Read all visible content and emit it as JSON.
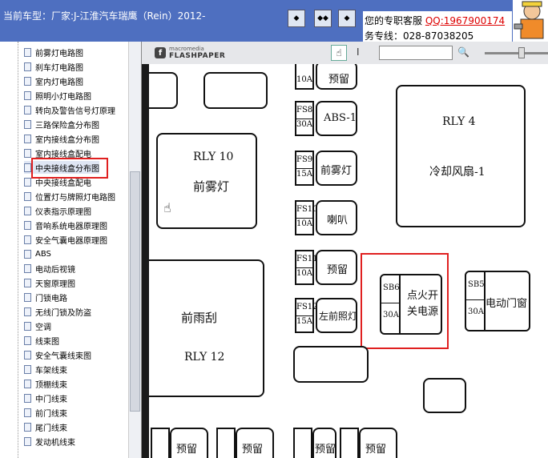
{
  "header": {
    "current_model": "当前车型：厂家:J-江淮汽车瑞鹰（Rein）2012-",
    "support_label": "您的专职客服",
    "qq": "QQ:1967900174",
    "hotline": "务专线：028-87038205",
    "nav_buttons": [
      "◆",
      "◆◆",
      "◆"
    ]
  },
  "sidebar": {
    "items": [
      "前雾灯电路图",
      "刹车灯电路图",
      "室内灯电路图",
      "照明小灯电路图",
      "转向及警告信号灯原理",
      "三路保险盒分布图",
      "室内接线盒分布图",
      "室内接线盒配电",
      "中央接线盒分布图",
      "中央接线盒配电",
      "位置灯与牌照灯电路图",
      "仪表指示原理图",
      "音响系统电器原理图",
      "安全气囊电器原理图",
      "ABS",
      "电动后视镜",
      "天窗原理图",
      "门锁电路",
      "无线门锁及防盗",
      "空调",
      "线束图",
      "安全气囊线束图",
      "车架线束",
      "顶棚线束",
      "中门线束",
      "前门线束",
      "尾门线束",
      "发动机线束"
    ],
    "selected_index": 8
  },
  "viewer": {
    "logo_top": "macromedia",
    "logo_bottom": "FLASHPAPER",
    "logo_f": "f",
    "hand_icon": "☝",
    "ibeam_icon": "I",
    "magnify_icon": "🔍",
    "diagram": {
      "rly10": "RLY 10",
      "fog_front": "前雾灯",
      "rly4": "RLY 4",
      "fan_low": "冷却风扇-1",
      "front_wiper": "前雨刮",
      "rly12": "RLY 12",
      "fs8": "FS8",
      "fs8_amp": "30A",
      "abs1": "ABS-1",
      "fs9": "FS9",
      "fs9_amp": "15A",
      "fs9_label": "前雾灯",
      "fs10": "FS10",
      "fs10_amp": "10A",
      "fs10_label": "喇叭",
      "fs11": "FS11",
      "fs11_amp": "10A",
      "fs11_label": "预留",
      "fs12": "FS12",
      "fs12_amp": "15A",
      "fs12_label": "左前照灯",
      "top_amp": "10A",
      "top_label": "预留",
      "sb6": "SB6",
      "sb6_amp": "30A",
      "sb6_label1": "点火开",
      "sb6_label2": "关电源",
      "sb5": "SB5",
      "sb5_amp": "30A",
      "sb5_label": "电动门窗",
      "reserve": "预留"
    }
  }
}
